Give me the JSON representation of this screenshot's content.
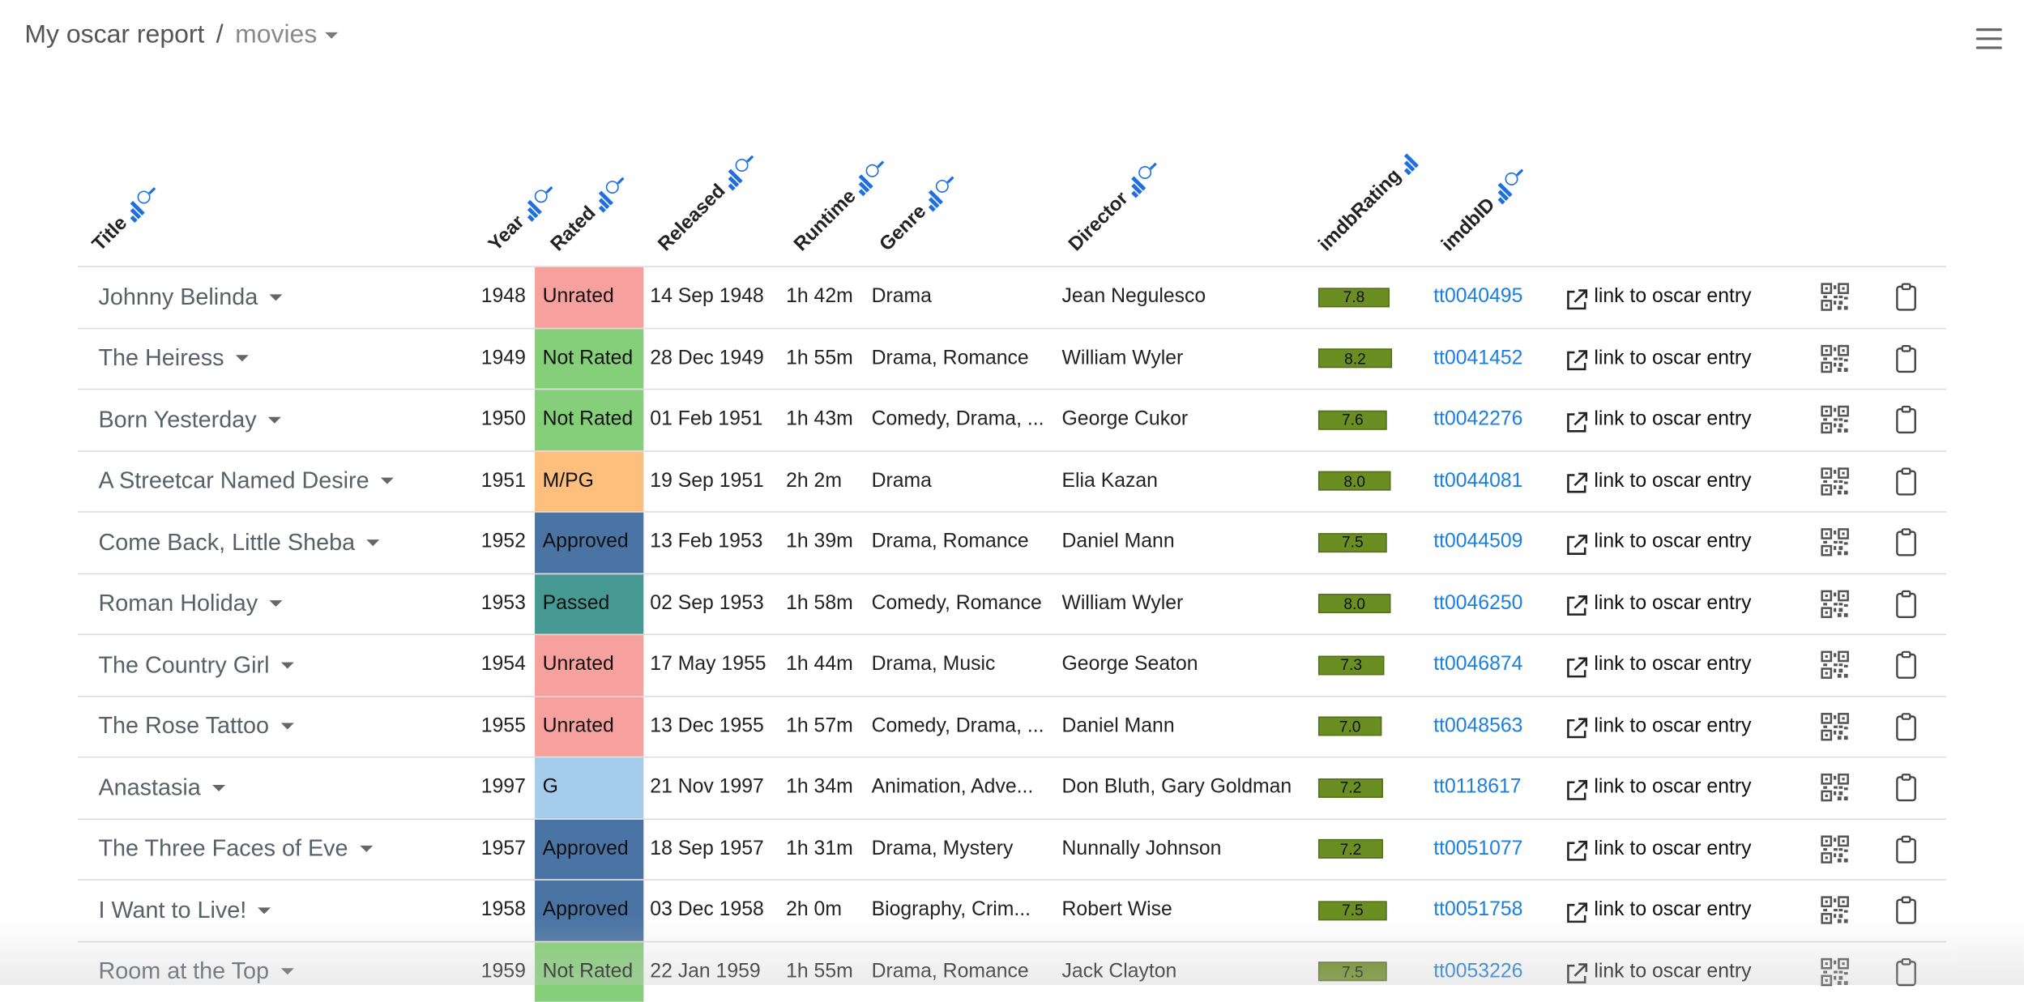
{
  "breadcrumb": {
    "app_name": "My oscar report",
    "separator": "/",
    "current": "movies"
  },
  "columns": [
    {
      "label": "Title",
      "sortable": true,
      "searchable": true
    },
    {
      "label": "Year",
      "sortable": true,
      "searchable": true
    },
    {
      "label": "Rated",
      "sortable": true,
      "searchable": true
    },
    {
      "label": "Released",
      "sortable": true,
      "searchable": true
    },
    {
      "label": "Runtime",
      "sortable": true,
      "searchable": true
    },
    {
      "label": "Genre",
      "sortable": true,
      "searchable": true
    },
    {
      "label": "Director",
      "sortable": true,
      "searchable": true
    },
    {
      "label": "imdbRating",
      "sortable": true,
      "searchable": false
    },
    {
      "label": "imdbID",
      "sortable": true,
      "searchable": true
    }
  ],
  "link_label": "link to oscar entry",
  "rated_colors": {
    "Unrated": "#f7a19e",
    "Not Rated": "#86cf7a",
    "M/PG": "#fdbf7e",
    "Approved": "#4a74a3",
    "Passed": "#479a94",
    "G": "#a5cdeb"
  },
  "rating_bar_color": "#6b8e23",
  "rows": [
    {
      "title": "Johnny Belinda",
      "year": "1948",
      "rated": "Unrated",
      "released": "14 Sep 1948",
      "runtime": "1h 42m",
      "genre": "Drama",
      "director": "Jean Negulesco",
      "rating": "7.8",
      "imdb_id": "tt0040495"
    },
    {
      "title": "The Heiress",
      "year": "1949",
      "rated": "Not Rated",
      "released": "28 Dec 1949",
      "runtime": "1h 55m",
      "genre": "Drama, Romance",
      "director": "William Wyler",
      "rating": "8.2",
      "imdb_id": "tt0041452"
    },
    {
      "title": "Born Yesterday",
      "year": "1950",
      "rated": "Not Rated",
      "released": "01 Feb 1951",
      "runtime": "1h 43m",
      "genre": "Comedy, Drama, ...",
      "director": "George Cukor",
      "rating": "7.6",
      "imdb_id": "tt0042276"
    },
    {
      "title": "A Streetcar Named Desire",
      "year": "1951",
      "rated": "M/PG",
      "released": "19 Sep 1951",
      "runtime": "2h 2m",
      "genre": "Drama",
      "director": "Elia Kazan",
      "rating": "8.0",
      "imdb_id": "tt0044081"
    },
    {
      "title": "Come Back, Little Sheba",
      "year": "1952",
      "rated": "Approved",
      "released": "13 Feb 1953",
      "runtime": "1h 39m",
      "genre": "Drama, Romance",
      "director": "Daniel Mann",
      "rating": "7.5",
      "imdb_id": "tt0044509"
    },
    {
      "title": "Roman Holiday",
      "year": "1953",
      "rated": "Passed",
      "released": "02 Sep 1953",
      "runtime": "1h 58m",
      "genre": "Comedy, Romance",
      "director": "William Wyler",
      "rating": "8.0",
      "imdb_id": "tt0046250"
    },
    {
      "title": "The Country Girl",
      "year": "1954",
      "rated": "Unrated",
      "released": "17 May 1955",
      "runtime": "1h 44m",
      "genre": "Drama, Music",
      "director": "George Seaton",
      "rating": "7.3",
      "imdb_id": "tt0046874"
    },
    {
      "title": "The Rose Tattoo",
      "year": "1955",
      "rated": "Unrated",
      "released": "13 Dec 1955",
      "runtime": "1h 57m",
      "genre": "Comedy, Drama, ...",
      "director": "Daniel Mann",
      "rating": "7.0",
      "imdb_id": "tt0048563"
    },
    {
      "title": "Anastasia",
      "year": "1997",
      "rated": "G",
      "released": "21 Nov 1997",
      "runtime": "1h 34m",
      "genre": "Animation, Adve...",
      "director": "Don Bluth, Gary Goldman",
      "rating": "7.2",
      "imdb_id": "tt0118617"
    },
    {
      "title": "The Three Faces of Eve",
      "year": "1957",
      "rated": "Approved",
      "released": "18 Sep 1957",
      "runtime": "1h 31m",
      "genre": "Drama, Mystery",
      "director": "Nunnally Johnson",
      "rating": "7.2",
      "imdb_id": "tt0051077"
    },
    {
      "title": "I Want to Live!",
      "year": "1958",
      "rated": "Approved",
      "released": "03 Dec 1958",
      "runtime": "2h 0m",
      "genre": "Biography, Crim...",
      "director": "Robert Wise",
      "rating": "7.5",
      "imdb_id": "tt0051758"
    },
    {
      "title": "Room at the Top",
      "year": "1959",
      "rated": "Not Rated",
      "released": "22 Jan 1959",
      "runtime": "1h 55m",
      "genre": "Drama, Romance",
      "director": "Jack Clayton",
      "rating": "7.5",
      "imdb_id": "tt0053226"
    }
  ]
}
